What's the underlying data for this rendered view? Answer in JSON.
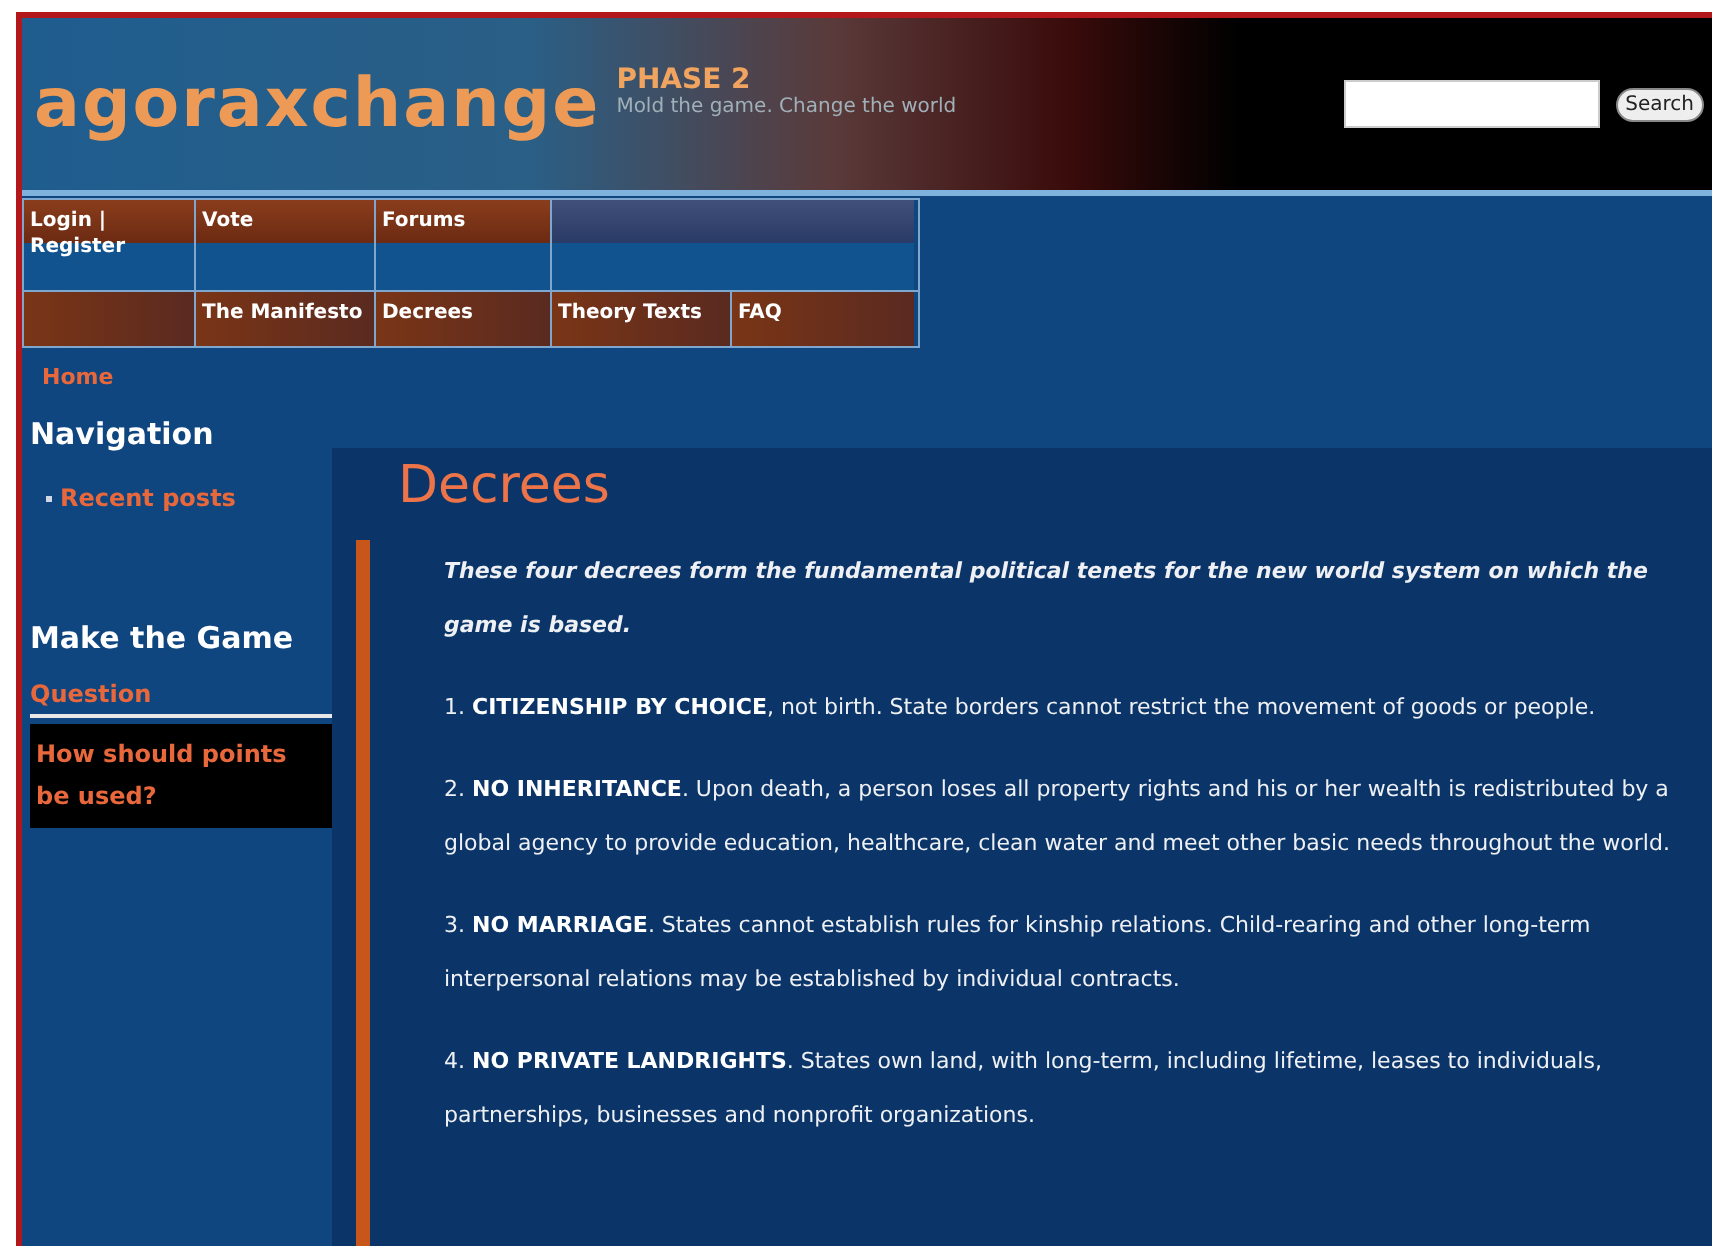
{
  "header": {
    "logo": "agoraxchange",
    "phase": "PHASE 2",
    "tagline": "Mold the game. Change the world",
    "search": {
      "button": "Search"
    }
  },
  "nav_rows": [
    [
      {
        "label": "Login |\nRegister"
      },
      {
        "label": "Vote"
      },
      {
        "label": "Forums"
      },
      {}
    ],
    [
      {},
      {
        "label": "The Manifesto"
      },
      {
        "label": "Decrees"
      },
      {
        "label": "Theory Texts"
      },
      {
        "label": "FAQ"
      }
    ]
  ],
  "breadcrumb": "Home",
  "sidebar": {
    "navigation": {
      "title": "Navigation",
      "items": [
        "Recent posts"
      ]
    },
    "make_the_game": {
      "title": "Make the Game",
      "subtitle": "Question",
      "question": "How should points be used?"
    }
  },
  "content": {
    "title": "Decrees",
    "intro": "These four decrees form the fundamental political tenets for the new world system on which the game is based.",
    "decrees": [
      "1. **CITIZENSHIP BY CHOICE**, not birth. State borders cannot restrict the movement of goods or people.",
      "2. **NO INHERITANCE**. Upon death, a person loses all property rights and his or her wealth is redistributed by a global agency to provide education, healthcare, clean water and meet other basic needs throughout the world.",
      "3. **NO MARRIAGE**. States cannot establish rules for kinship relations. Child-rearing and other long-term interpersonal relations may be established by individual contracts.",
      "4. **NO PRIVATE LANDRIGHTS**. States own land, with long-term, including lifetime, leases to individuals, partnerships, businesses and nonprofit organizations."
    ]
  }
}
